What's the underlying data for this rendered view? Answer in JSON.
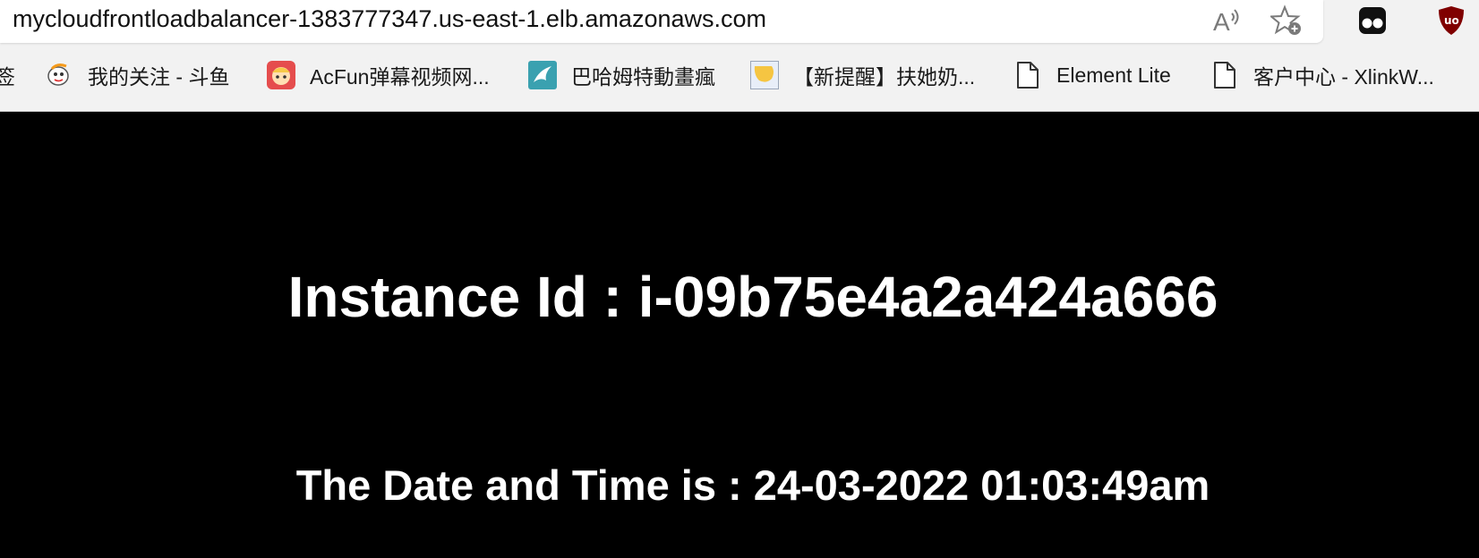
{
  "browser": {
    "url": "mycloudfrontloadbalancer-1383777347.us-east-1.elb.amazonaws.com",
    "read_aloud_icon": "read-aloud-icon",
    "favorite_icon": "add-favorite-icon",
    "extensions": [
      "tampermonkey-extension-icon",
      "ublock-origin-extension-icon"
    ]
  },
  "bookmarks": [
    {
      "label": "签",
      "icon": "bookmark-partial-icon"
    },
    {
      "label": "我的关注 - 斗鱼",
      "icon": "douyu-icon"
    },
    {
      "label": "AcFun弹幕视频网...",
      "icon": "acfun-icon"
    },
    {
      "label": "巴哈姆特動畫瘋",
      "icon": "bahamut-icon"
    },
    {
      "label": "【新提醒】扶她奶...",
      "icon": "site-favicon"
    },
    {
      "label": "Element Lite",
      "icon": "page-icon"
    },
    {
      "label": "客户中心 - XlinkW...",
      "icon": "page-icon"
    }
  ],
  "content": {
    "instance_line": "Instance Id : i-09b75e4a2a424a666",
    "datetime_line": "The Date and Time is : 24-03-2022 01:03:49am"
  }
}
